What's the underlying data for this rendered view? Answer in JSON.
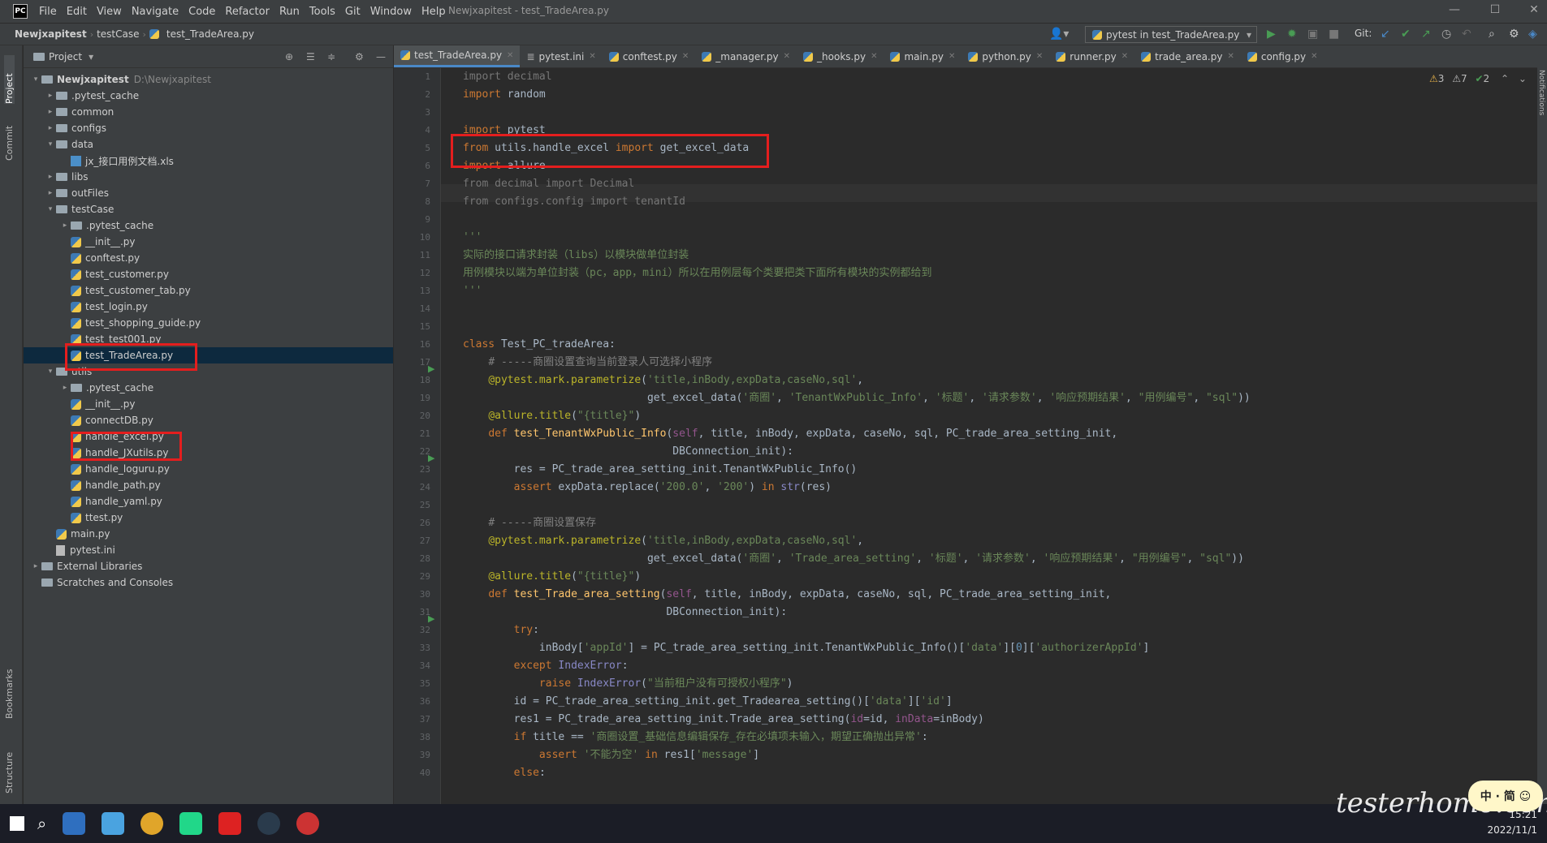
{
  "window": {
    "app_logo": "PC",
    "title": "Newjxapitest - test_TradeArea.py",
    "menu": [
      "File",
      "Edit",
      "View",
      "Navigate",
      "Code",
      "Refactor",
      "Run",
      "Tools",
      "Git",
      "Window",
      "Help"
    ],
    "controls": [
      "—",
      "☐",
      "✕"
    ]
  },
  "navbar": {
    "breadcrumbs": [
      "Newjxapitest",
      "testCase",
      "test_TradeArea.py"
    ],
    "run_config": "pytest in test_TradeArea.py",
    "git_label": "Git:"
  },
  "left_strip": {
    "tabs": [
      "Project",
      "Commit",
      "Bookmarks",
      "Structure"
    ]
  },
  "right_strip": {
    "notifications": "Notifications"
  },
  "project_panel": {
    "title": "Project",
    "tree": [
      {
        "label": "Newjxapitest",
        "hint": "D:\\Newjxapitest",
        "type": "folder",
        "expanded": true
      },
      {
        "label": ".pytest_cache",
        "type": "folder"
      },
      {
        "label": "common",
        "type": "folder"
      },
      {
        "label": "configs",
        "type": "folder"
      },
      {
        "label": "data",
        "type": "folder",
        "expanded": true
      },
      {
        "label": "jx_接口用例文档.xls",
        "type": "xls"
      },
      {
        "label": "libs",
        "type": "folder"
      },
      {
        "label": "outFiles",
        "type": "folder"
      },
      {
        "label": "testCase",
        "type": "folder",
        "expanded": true
      },
      {
        "label": ".pytest_cache",
        "type": "folder"
      },
      {
        "label": "__init__.py",
        "type": "py"
      },
      {
        "label": "conftest.py",
        "type": "py"
      },
      {
        "label": "test_customer.py",
        "type": "py"
      },
      {
        "label": "test_customer_tab.py",
        "type": "py"
      },
      {
        "label": "test_login.py",
        "type": "py"
      },
      {
        "label": "test_shopping_guide.py",
        "type": "py"
      },
      {
        "label": "test_test001.py",
        "type": "py"
      },
      {
        "label": "test_TradeArea.py",
        "type": "py",
        "selected": true
      },
      {
        "label": "utils",
        "type": "folder",
        "expanded": true
      },
      {
        "label": ".pytest_cache",
        "type": "folder"
      },
      {
        "label": "__init__.py",
        "type": "py"
      },
      {
        "label": "connectDB.py",
        "type": "py"
      },
      {
        "label": "handle_excel.py",
        "type": "py"
      },
      {
        "label": "handle_JXutils.py",
        "type": "py"
      },
      {
        "label": "handle_loguru.py",
        "type": "py"
      },
      {
        "label": "handle_path.py",
        "type": "py"
      },
      {
        "label": "handle_yaml.py",
        "type": "py"
      },
      {
        "label": "ttest.py",
        "type": "py"
      },
      {
        "label": "main.py",
        "type": "py"
      },
      {
        "label": "pytest.ini",
        "type": "file"
      },
      {
        "label": "External Libraries",
        "type": "lib"
      },
      {
        "label": "Scratches and Consoles",
        "type": "scratch"
      }
    ]
  },
  "editor": {
    "tabs": [
      "test_TradeArea.py",
      "pytest.ini",
      "conftest.py",
      "_manager.py",
      "_hooks.py",
      "main.py",
      "python.py",
      "runner.py",
      "trade_area.py",
      "config.py"
    ],
    "inspections": {
      "warnings": "3",
      "weak": "7",
      "ok": "2"
    },
    "line_numbers": [
      "1",
      "2",
      "3",
      "4",
      "5",
      "6",
      "7",
      "8",
      "9",
      "10",
      "11",
      "12",
      "13",
      "14",
      "15",
      "16",
      "17",
      "18",
      "19",
      "20",
      "21",
      "22",
      "23",
      "24",
      "25",
      "26",
      "27",
      "28",
      "29",
      "30",
      "31",
      "32",
      "33",
      "34",
      "35",
      "36",
      "37",
      "38",
      "39",
      "40"
    ]
  },
  "taskbar": {
    "time": "15:21",
    "date": "2022/11/1",
    "watermark": "testerhome.com",
    "ime": "中 · 简 ☺"
  }
}
